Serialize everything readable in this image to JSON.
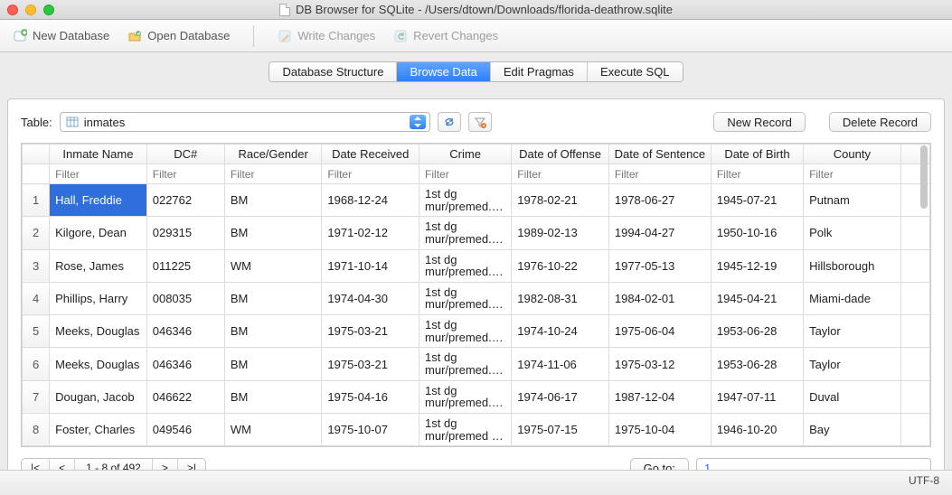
{
  "window": {
    "app": "DB Browser for SQLite",
    "path": "/Users/dtown/Downloads/florida-deathrow.sqlite",
    "title": "DB Browser for SQLite - /Users/dtown/Downloads/florida-deathrow.sqlite"
  },
  "toolbar": {
    "new_db": "New Database",
    "open_db": "Open Database",
    "write": "Write Changes",
    "revert": "Revert Changes"
  },
  "tabs": {
    "structure": "Database Structure",
    "browse": "Browse Data",
    "pragmas": "Edit Pragmas",
    "sql": "Execute SQL"
  },
  "browse": {
    "table_label": "Table:",
    "table_name": "inmates",
    "new_record": "New Record",
    "delete_record": "Delete Record",
    "filter_placeholder": "Filter",
    "columns": [
      "Inmate Name",
      "DC#",
      "Race/Gender",
      "Date Received",
      "Crime",
      "Date of Offense",
      "Date of Sentence",
      "Date of Birth",
      "County"
    ],
    "rows": [
      {
        "n": "1",
        "name": "Hall, Freddie",
        "dc": "022762",
        "rg": "BM",
        "recv": "1968-12-24",
        "crime": "1st dg mur/premed. …",
        "off": "1978-02-21",
        "sent": "1978-06-27",
        "dob": "1945-07-21",
        "county": "Putnam"
      },
      {
        "n": "2",
        "name": "Kilgore, Dean",
        "dc": "029315",
        "rg": "BM",
        "recv": "1971-02-12",
        "crime": "1st dg mur/premed. …",
        "off": "1989-02-13",
        "sent": "1994-04-27",
        "dob": "1950-10-16",
        "county": "Polk"
      },
      {
        "n": "3",
        "name": "Rose, James",
        "dc": "011225",
        "rg": "WM",
        "recv": "1971-10-14",
        "crime": "1st dg mur/premed. …",
        "off": "1976-10-22",
        "sent": "1977-05-13",
        "dob": "1945-12-19",
        "county": "Hillsborough"
      },
      {
        "n": "4",
        "name": "Phillips, Harry",
        "dc": "008035",
        "rg": "BM",
        "recv": "1974-04-30",
        "crime": "1st dg mur/premed. …",
        "off": "1982-08-31",
        "sent": "1984-02-01",
        "dob": "1945-04-21",
        "county": "Miami-dade"
      },
      {
        "n": "5",
        "name": "Meeks, Douglas",
        "dc": "046346",
        "rg": "BM",
        "recv": "1975-03-21",
        "crime": "1st dg mur/premed. …",
        "off": "1974-10-24",
        "sent": "1975-06-04",
        "dob": "1953-06-28",
        "county": "Taylor"
      },
      {
        "n": "6",
        "name": "Meeks, Douglas",
        "dc": "046346",
        "rg": "BM",
        "recv": "1975-03-21",
        "crime": "1st dg mur/premed. …",
        "off": "1974-11-06",
        "sent": "1975-03-12",
        "dob": "1953-06-28",
        "county": "Taylor"
      },
      {
        "n": "7",
        "name": "Dougan, Jacob",
        "dc": "046622",
        "rg": "BM",
        "recv": "1975-04-16",
        "crime": "1st dg mur/premed. …",
        "off": "1974-06-17",
        "sent": "1987-12-04",
        "dob": "1947-07-11",
        "county": "Duval"
      },
      {
        "n": "8",
        "name": "Foster, Charles",
        "dc": "049546",
        "rg": "WM",
        "recv": "1975-10-07",
        "crime": "1st dg mur/premed …",
        "off": "1975-07-15",
        "sent": "1975-10-04",
        "dob": "1946-10-20",
        "county": "Bay"
      }
    ]
  },
  "pager": {
    "first": "|<",
    "prev": "<",
    "status": "1 - 8 of 492",
    "next": ">",
    "last": ">|",
    "goto": "Go to:",
    "goto_value": "1"
  },
  "status": {
    "encoding": "UTF-8"
  }
}
